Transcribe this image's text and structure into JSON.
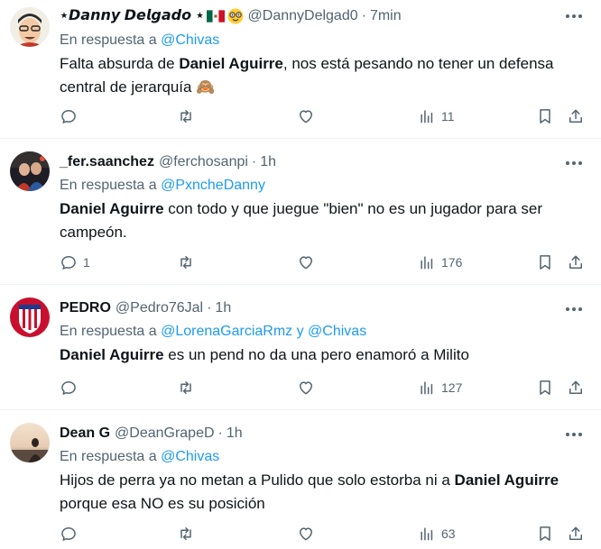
{
  "tweets": [
    {
      "name_prefix": "⋆",
      "name": "𝘿𝙖𝙣𝙣𝙮 𝘿𝙚𝙡𝙜𝙖𝙙𝙤",
      "name_suffix": "⋆",
      "handle": "@DannyDelgad0",
      "time": "7min",
      "reply_prefix": "En respuesta a",
      "reply_to": "@Chivas",
      "body_before": "Falta absurda de ",
      "body_bold": "Daniel Aguirre",
      "body_after": ", nos está pesando no tener un defensa central de jerarquía 🙈",
      "replies": "",
      "views": "11"
    },
    {
      "name": "_fer.saanchez",
      "handle": "@ferchosanpi",
      "time": "1h",
      "reply_prefix": "En respuesta a",
      "reply_to": "@PxncheDanny",
      "body_before": "",
      "body_bold": "Daniel Aguirre",
      "body_after": " con todo y que juegue \"bien\" no es un jugador para ser campeón.",
      "replies": "1",
      "views": "176"
    },
    {
      "name": "PEDRO",
      "handle": "@Pedro76Jal",
      "time": "1h",
      "reply_prefix": "En respuesta a",
      "reply_to": "@LorenaGarciaRmz y @Chivas",
      "body_before": "",
      "body_bold": "Daniel Aguirre",
      "body_after": " es un pend no da una pero enamoró a Milito",
      "replies": "",
      "views": "127"
    },
    {
      "name": "Dean G",
      "handle": "@DeanGrapeD",
      "time": "1h",
      "reply_prefix": "En respuesta a",
      "reply_to": "@Chivas",
      "body_before": "Hijos de perra ya no metan a Pulido que solo estorba ni a ",
      "body_bold": "Daniel Aguirre",
      "body_after": " porque esa NO es su posición",
      "replies": "",
      "views": "63"
    }
  ],
  "colors": {
    "text": "#0f1419",
    "secondary": "#536471",
    "link": "#1d9bf0",
    "divider": "#eff3f4"
  },
  "icons": [
    "reply-icon",
    "retweet-icon",
    "like-icon",
    "views-icon",
    "bookmark-icon",
    "share-icon",
    "more-icon"
  ]
}
